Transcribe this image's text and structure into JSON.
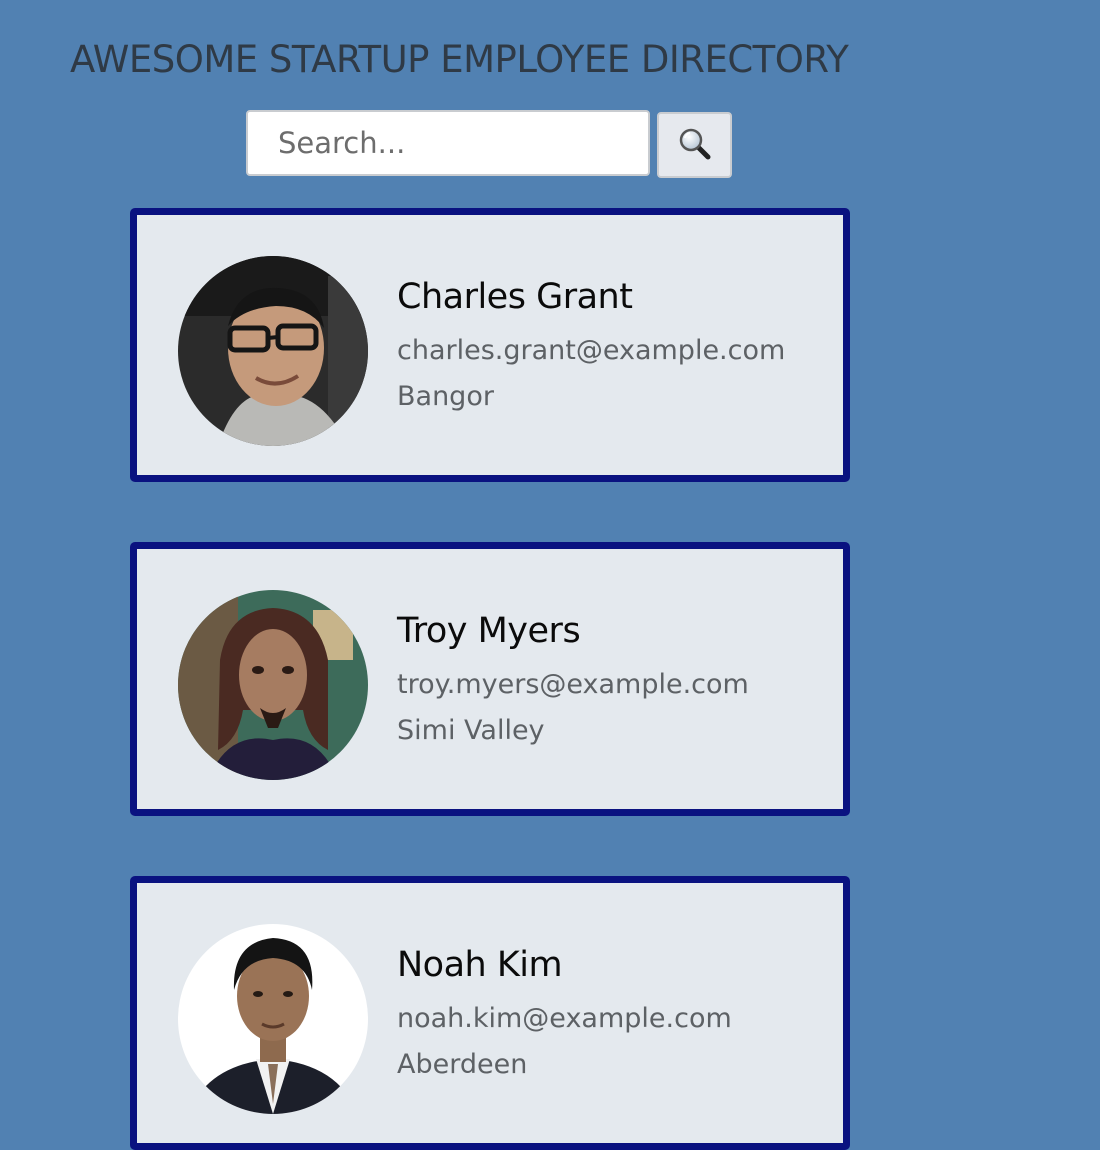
{
  "page_title": "AWESOME STARTUP EMPLOYEE DIRECTORY",
  "search": {
    "placeholder": "Search...",
    "value": "",
    "button_icon": "magnifying-glass-icon"
  },
  "colors": {
    "background": "#5181b2",
    "card_border": "#0a1280",
    "card_background": "#e4e9ee"
  },
  "employees": [
    {
      "name": "Charles Grant",
      "email": "charles.grant@example.com",
      "city": "Bangor"
    },
    {
      "name": "Troy Myers",
      "email": "troy.myers@example.com",
      "city": "Simi Valley"
    },
    {
      "name": "Noah Kim",
      "email": "noah.kim@example.com",
      "city": "Aberdeen"
    }
  ]
}
